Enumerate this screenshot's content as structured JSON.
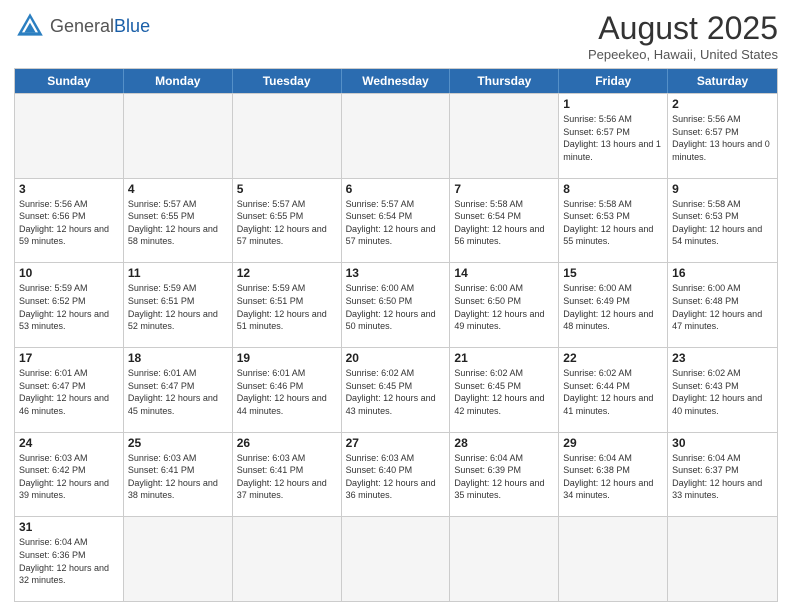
{
  "header": {
    "logo": {
      "general": "General",
      "blue": "Blue"
    },
    "title": "August 2025",
    "location": "Pepeekeo, Hawaii, United States"
  },
  "days_of_week": [
    "Sunday",
    "Monday",
    "Tuesday",
    "Wednesday",
    "Thursday",
    "Friday",
    "Saturday"
  ],
  "weeks": [
    [
      {
        "day": "",
        "empty": true
      },
      {
        "day": "",
        "empty": true
      },
      {
        "day": "",
        "empty": true
      },
      {
        "day": "",
        "empty": true
      },
      {
        "day": "",
        "empty": true
      },
      {
        "day": "1",
        "sunrise": "Sunrise: 5:56 AM",
        "sunset": "Sunset: 6:57 PM",
        "daylight": "Daylight: 13 hours and 1 minute."
      },
      {
        "day": "2",
        "sunrise": "Sunrise: 5:56 AM",
        "sunset": "Sunset: 6:57 PM",
        "daylight": "Daylight: 13 hours and 0 minutes."
      }
    ],
    [
      {
        "day": "3",
        "sunrise": "Sunrise: 5:56 AM",
        "sunset": "Sunset: 6:56 PM",
        "daylight": "Daylight: 12 hours and 59 minutes."
      },
      {
        "day": "4",
        "sunrise": "Sunrise: 5:57 AM",
        "sunset": "Sunset: 6:55 PM",
        "daylight": "Daylight: 12 hours and 58 minutes."
      },
      {
        "day": "5",
        "sunrise": "Sunrise: 5:57 AM",
        "sunset": "Sunset: 6:55 PM",
        "daylight": "Daylight: 12 hours and 57 minutes."
      },
      {
        "day": "6",
        "sunrise": "Sunrise: 5:57 AM",
        "sunset": "Sunset: 6:54 PM",
        "daylight": "Daylight: 12 hours and 57 minutes."
      },
      {
        "day": "7",
        "sunrise": "Sunrise: 5:58 AM",
        "sunset": "Sunset: 6:54 PM",
        "daylight": "Daylight: 12 hours and 56 minutes."
      },
      {
        "day": "8",
        "sunrise": "Sunrise: 5:58 AM",
        "sunset": "Sunset: 6:53 PM",
        "daylight": "Daylight: 12 hours and 55 minutes."
      },
      {
        "day": "9",
        "sunrise": "Sunrise: 5:58 AM",
        "sunset": "Sunset: 6:53 PM",
        "daylight": "Daylight: 12 hours and 54 minutes."
      }
    ],
    [
      {
        "day": "10",
        "sunrise": "Sunrise: 5:59 AM",
        "sunset": "Sunset: 6:52 PM",
        "daylight": "Daylight: 12 hours and 53 minutes."
      },
      {
        "day": "11",
        "sunrise": "Sunrise: 5:59 AM",
        "sunset": "Sunset: 6:51 PM",
        "daylight": "Daylight: 12 hours and 52 minutes."
      },
      {
        "day": "12",
        "sunrise": "Sunrise: 5:59 AM",
        "sunset": "Sunset: 6:51 PM",
        "daylight": "Daylight: 12 hours and 51 minutes."
      },
      {
        "day": "13",
        "sunrise": "Sunrise: 6:00 AM",
        "sunset": "Sunset: 6:50 PM",
        "daylight": "Daylight: 12 hours and 50 minutes."
      },
      {
        "day": "14",
        "sunrise": "Sunrise: 6:00 AM",
        "sunset": "Sunset: 6:50 PM",
        "daylight": "Daylight: 12 hours and 49 minutes."
      },
      {
        "day": "15",
        "sunrise": "Sunrise: 6:00 AM",
        "sunset": "Sunset: 6:49 PM",
        "daylight": "Daylight: 12 hours and 48 minutes."
      },
      {
        "day": "16",
        "sunrise": "Sunrise: 6:00 AM",
        "sunset": "Sunset: 6:48 PM",
        "daylight": "Daylight: 12 hours and 47 minutes."
      }
    ],
    [
      {
        "day": "17",
        "sunrise": "Sunrise: 6:01 AM",
        "sunset": "Sunset: 6:47 PM",
        "daylight": "Daylight: 12 hours and 46 minutes."
      },
      {
        "day": "18",
        "sunrise": "Sunrise: 6:01 AM",
        "sunset": "Sunset: 6:47 PM",
        "daylight": "Daylight: 12 hours and 45 minutes."
      },
      {
        "day": "19",
        "sunrise": "Sunrise: 6:01 AM",
        "sunset": "Sunset: 6:46 PM",
        "daylight": "Daylight: 12 hours and 44 minutes."
      },
      {
        "day": "20",
        "sunrise": "Sunrise: 6:02 AM",
        "sunset": "Sunset: 6:45 PM",
        "daylight": "Daylight: 12 hours and 43 minutes."
      },
      {
        "day": "21",
        "sunrise": "Sunrise: 6:02 AM",
        "sunset": "Sunset: 6:45 PM",
        "daylight": "Daylight: 12 hours and 42 minutes."
      },
      {
        "day": "22",
        "sunrise": "Sunrise: 6:02 AM",
        "sunset": "Sunset: 6:44 PM",
        "daylight": "Daylight: 12 hours and 41 minutes."
      },
      {
        "day": "23",
        "sunrise": "Sunrise: 6:02 AM",
        "sunset": "Sunset: 6:43 PM",
        "daylight": "Daylight: 12 hours and 40 minutes."
      }
    ],
    [
      {
        "day": "24",
        "sunrise": "Sunrise: 6:03 AM",
        "sunset": "Sunset: 6:42 PM",
        "daylight": "Daylight: 12 hours and 39 minutes."
      },
      {
        "day": "25",
        "sunrise": "Sunrise: 6:03 AM",
        "sunset": "Sunset: 6:41 PM",
        "daylight": "Daylight: 12 hours and 38 minutes."
      },
      {
        "day": "26",
        "sunrise": "Sunrise: 6:03 AM",
        "sunset": "Sunset: 6:41 PM",
        "daylight": "Daylight: 12 hours and 37 minutes."
      },
      {
        "day": "27",
        "sunrise": "Sunrise: 6:03 AM",
        "sunset": "Sunset: 6:40 PM",
        "daylight": "Daylight: 12 hours and 36 minutes."
      },
      {
        "day": "28",
        "sunrise": "Sunrise: 6:04 AM",
        "sunset": "Sunset: 6:39 PM",
        "daylight": "Daylight: 12 hours and 35 minutes."
      },
      {
        "day": "29",
        "sunrise": "Sunrise: 6:04 AM",
        "sunset": "Sunset: 6:38 PM",
        "daylight": "Daylight: 12 hours and 34 minutes."
      },
      {
        "day": "30",
        "sunrise": "Sunrise: 6:04 AM",
        "sunset": "Sunset: 6:37 PM",
        "daylight": "Daylight: 12 hours and 33 minutes."
      }
    ],
    [
      {
        "day": "31",
        "sunrise": "Sunrise: 6:04 AM",
        "sunset": "Sunset: 6:36 PM",
        "daylight": "Daylight: 12 hours and 32 minutes."
      },
      {
        "day": "",
        "empty": true
      },
      {
        "day": "",
        "empty": true
      },
      {
        "day": "",
        "empty": true
      },
      {
        "day": "",
        "empty": true
      },
      {
        "day": "",
        "empty": true
      },
      {
        "day": "",
        "empty": true
      }
    ]
  ]
}
